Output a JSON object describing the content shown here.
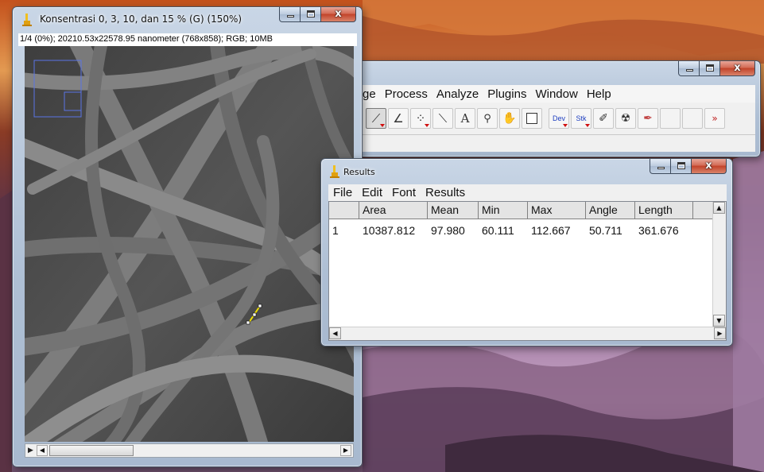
{
  "desktop": {
    "wallpaper": "canyon-landscape"
  },
  "image_window": {
    "title": "Konsentrasi 0, 3, 10, dan 15 % (G) (150%)",
    "info": "1/4 (0%); 20210.53x22578.95 nanometer (768x858); RGB; 10MB",
    "controls": {
      "minimize": "—",
      "maximize": "□",
      "close": "x"
    },
    "play_glyph": "▶",
    "left_arrow": "◀",
    "right_arrow": "▶"
  },
  "imagej_window": {
    "menu": [
      "ge",
      "Process",
      "Analyze",
      "Plugins",
      "Window",
      "Help"
    ],
    "tools": [
      {
        "icon": "line-tool-icon",
        "glyph": "⟋",
        "selected": true,
        "dropdown": true
      },
      {
        "icon": "angle-tool-icon",
        "glyph": "∠"
      },
      {
        "icon": "point-tool-icon",
        "glyph": "⁘",
        "dropdown": true
      },
      {
        "icon": "wand-tool-icon",
        "glyph": "⟍"
      },
      {
        "icon": "text-tool-icon",
        "glyph": "A"
      },
      {
        "icon": "magnifier-tool-icon",
        "glyph": "🔍"
      },
      {
        "icon": "hand-tool-icon",
        "glyph": "✋"
      },
      {
        "icon": "color-picker-icon",
        "glyph": ""
      },
      {
        "icon": "developer-menu-icon",
        "glyph": "Dev",
        "text": true,
        "dropdown": true
      },
      {
        "icon": "stack-menu-icon",
        "glyph": "Stk",
        "text": true,
        "dropdown": true
      },
      {
        "icon": "brush-tool-icon",
        "glyph": "🖌"
      },
      {
        "icon": "flood-fill-icon",
        "glyph": "⚲"
      },
      {
        "icon": "pencil-tool-icon",
        "glyph": "✎"
      },
      {
        "icon": "empty-slot-icon",
        "glyph": ""
      },
      {
        "icon": "empty-slot-icon",
        "glyph": ""
      }
    ],
    "more": "»",
    "controls": {
      "minimize": "—",
      "maximize": "□",
      "close": "x"
    }
  },
  "results_window": {
    "title": "Results",
    "menu": [
      "File",
      "Edit",
      "Font",
      "Results"
    ],
    "columns": [
      "",
      "Area",
      "Mean",
      "Min",
      "Max",
      "Angle",
      "Length"
    ],
    "rows": [
      [
        "1",
        "10387.812",
        "97.980",
        "60.111",
        "112.667",
        "50.711",
        "361.676"
      ]
    ],
    "controls": {
      "minimize": "—",
      "maximize": "□",
      "close": "x"
    },
    "up_arrow": "▲",
    "down_arrow": "▼",
    "left_arrow": "◀",
    "right_arrow": "▶"
  }
}
